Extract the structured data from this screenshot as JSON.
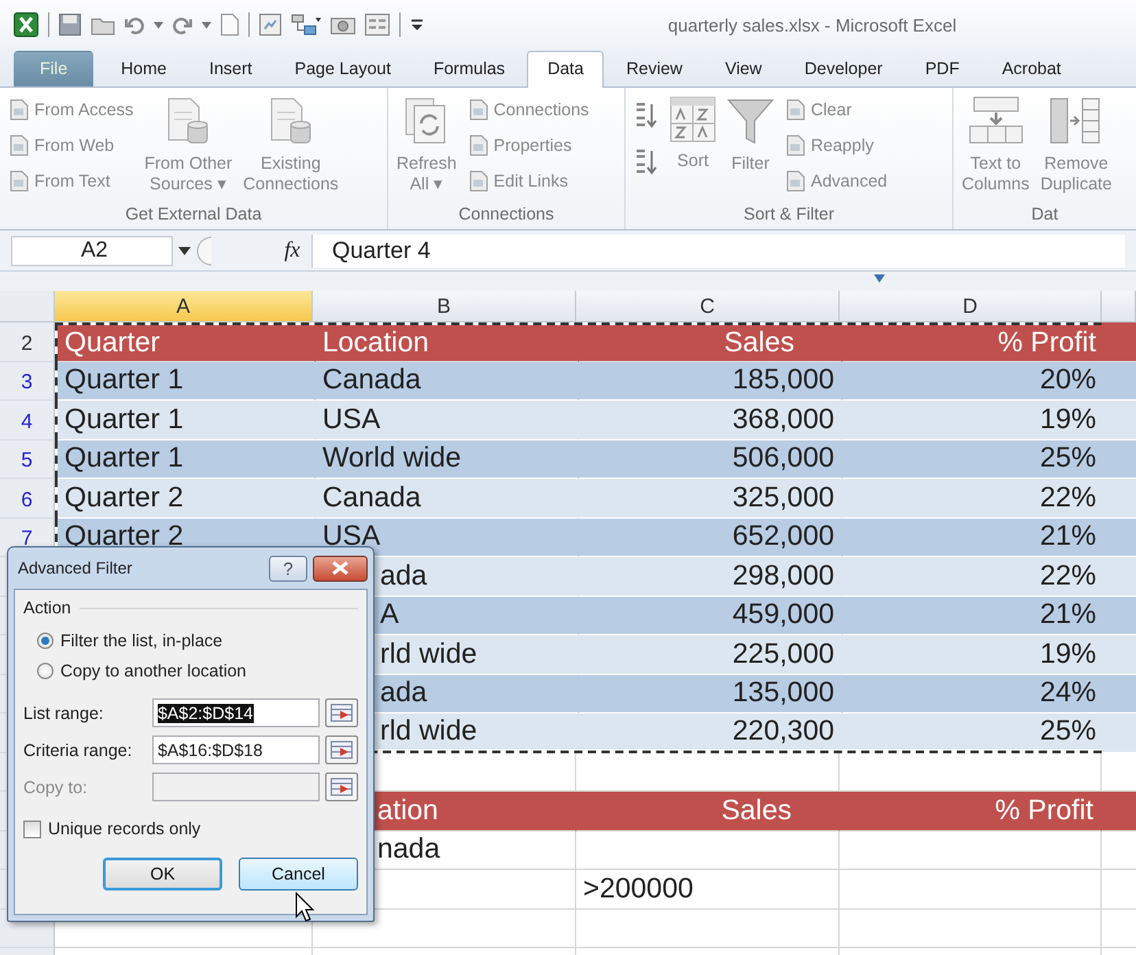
{
  "window": {
    "title": "quarterly sales.xlsx - Microsoft Excel"
  },
  "tabs": [
    {
      "label": "File",
      "kind": "file",
      "selected": false
    },
    {
      "label": "Home",
      "kind": "tab",
      "selected": false
    },
    {
      "label": "Insert",
      "kind": "tab",
      "selected": false
    },
    {
      "label": "Page Layout",
      "kind": "tab",
      "selected": false
    },
    {
      "label": "Formulas",
      "kind": "tab",
      "selected": false
    },
    {
      "label": "Data",
      "kind": "tab",
      "selected": true
    },
    {
      "label": "Review",
      "kind": "tab",
      "selected": false
    },
    {
      "label": "View",
      "kind": "tab",
      "selected": false
    },
    {
      "label": "Developer",
      "kind": "tab",
      "selected": false
    },
    {
      "label": "PDF",
      "kind": "tab",
      "selected": false
    },
    {
      "label": "Acrobat",
      "kind": "tab",
      "selected": false
    }
  ],
  "ribbon_groups": [
    {
      "label": "Get External Data",
      "columns": [
        {
          "kind": "stack",
          "items": [
            "From Access",
            "From Web",
            "From Text"
          ]
        },
        {
          "kind": "data-source",
          "lines": [
            "From Other",
            "Sources ▾"
          ]
        },
        {
          "kind": "data-source",
          "lines": [
            "Existing",
            "Connections"
          ]
        }
      ]
    },
    {
      "label": "Connections",
      "columns": [
        {
          "kind": "refresh",
          "lines": [
            "Refresh",
            "All ▾"
          ]
        },
        {
          "kind": "stack",
          "items": [
            "Connections",
            "Properties",
            "Edit Links"
          ]
        }
      ]
    },
    {
      "label": "Sort & Filter",
      "columns": [
        {
          "kind": "sort-pair"
        },
        {
          "kind": "sort",
          "lines": [
            "Sort"
          ]
        },
        {
          "kind": "filter",
          "lines": [
            "Filter"
          ]
        },
        {
          "kind": "stack",
          "items": [
            "Clear",
            "Reapply",
            "Advanced"
          ]
        }
      ]
    },
    {
      "label": "Dat",
      "columns": [
        {
          "kind": "columns",
          "lines": [
            "Text to",
            "Columns"
          ]
        },
        {
          "kind": "dedupe",
          "lines": [
            "Remove",
            "Duplicate"
          ]
        }
      ]
    }
  ],
  "formula_bar": {
    "name_box": "A2",
    "function_label": "fx",
    "value": "Quarter 4"
  },
  "sheet": {
    "copy_marquee": true,
    "columns": [
      {
        "label": "A",
        "selected": true
      },
      {
        "label": "B",
        "selected": false
      },
      {
        "label": "C",
        "selected": false
      },
      {
        "label": "D",
        "selected": false
      }
    ],
    "rows": [
      {
        "number": "2",
        "filtered": false,
        "kind": "header",
        "quarter": "Quarter",
        "location": "Location",
        "sales": "Sales",
        "profit": "% Profit"
      },
      {
        "number": "3",
        "filtered": true,
        "kind": "band-dark",
        "quarter": "Quarter 1",
        "location": "Canada",
        "sales": "185,000",
        "profit": "20%"
      },
      {
        "number": "4",
        "filtered": true,
        "kind": "band-light",
        "quarter": "Quarter 1",
        "location": "USA",
        "sales": "368,000",
        "profit": "19%"
      },
      {
        "number": "5",
        "filtered": true,
        "kind": "band-dark",
        "quarter": "Quarter 1",
        "location": "World wide",
        "sales": "506,000",
        "profit": "25%"
      },
      {
        "number": "6",
        "filtered": true,
        "kind": "band-light",
        "quarter": "Quarter 2",
        "location": "Canada",
        "sales": "325,000",
        "profit": "22%"
      },
      {
        "number": "7",
        "filtered": true,
        "kind": "band-dark",
        "quarter": "Quarter 2",
        "location": "USA",
        "sales": "652,000",
        "profit": "21%"
      },
      {
        "kind": "band-light",
        "location": "ada",
        "cut": true,
        "sales": "298,000",
        "profit": "22%"
      },
      {
        "kind": "band-dark",
        "location": "A",
        "cut": true,
        "sales": "459,000",
        "profit": "21%"
      },
      {
        "kind": "band-light",
        "location": "rld wide",
        "cut": true,
        "sales": "225,000",
        "profit": "19%"
      },
      {
        "kind": "band-dark",
        "location": "ada",
        "cut": true,
        "sales": "135,000",
        "profit": "24%"
      },
      {
        "kind": "band-light",
        "location": "rld wide",
        "cut": true,
        "sales": "220,300",
        "profit": "25%"
      },
      {
        "kind": "blank"
      },
      {
        "kind": "header",
        "location": "ation",
        "cut": true,
        "sales": "Sales",
        "profit": "% Profit"
      },
      {
        "kind": "criteria",
        "location": "nada",
        "cut": true
      },
      {
        "kind": "criteria",
        "sales": ">200000"
      },
      {
        "kind": "blank"
      },
      {
        "kind": "blank"
      }
    ]
  },
  "dialog": {
    "title": "Advanced Filter",
    "help_label": "?",
    "section": "Action",
    "options": [
      {
        "label": "Filter the list, in-place",
        "selected": true
      },
      {
        "label": "Copy to another location",
        "selected": false
      }
    ],
    "fields": [
      {
        "label": "List range:",
        "value": "$A$2:$D$14",
        "value_selected": true,
        "disabled": false
      },
      {
        "label": "Criteria range:",
        "value": "$A$16:$D$18",
        "value_selected": false,
        "disabled": false
      },
      {
        "label": "Copy to:",
        "disabled": true
      }
    ],
    "checkbox": {
      "label": "Unique records only",
      "checked": false
    },
    "buttons": [
      {
        "label": "OK",
        "default": true,
        "hovered": false
      },
      {
        "label": "Cancel",
        "default": false,
        "hovered": true
      }
    ]
  }
}
